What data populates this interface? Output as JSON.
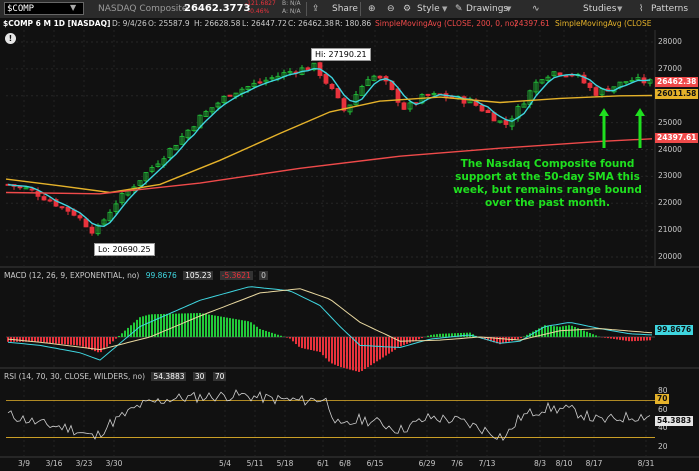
{
  "toolbar": {
    "symbol": "$COMP",
    "name": "NASDAQ Composite",
    "price": "26462.3773",
    "change": "-121.6827",
    "change_pct": "-0.46%",
    "bid": "B: N/A",
    "ask": "A: N/A",
    "share": "Share",
    "style": "Style",
    "drawings": "Drawings",
    "studies": "Studies",
    "patterns": "Patterns"
  },
  "info_bar": {
    "title": "$COMP 6 M 1D [NASDAQ]",
    "date": "D: 9/4/26",
    "open": "O: 25587.9",
    "high": "H: 26628.58",
    "low": "L: 26447.72",
    "close": "C: 26462.38",
    "range": "R: 180.86",
    "sma200": "SimpleMovingAvg (CLOSE, 200, 0, no)",
    "sma200_val": "24397.61",
    "sma50": "SimpleMovingAvg (CLOSE"
  },
  "price_axis": [
    "28000",
    "27000",
    "26000",
    "25000",
    "24000",
    "23000",
    "22000",
    "21000",
    "20000"
  ],
  "price_tags": {
    "last": "26462.38",
    "sma50": "26011.58",
    "sma200": "24397.61"
  },
  "callouts": {
    "hi": "Hi: 27190.21",
    "lo": "Lo: 20690.25"
  },
  "annotation": "The Nasdaq Composite found support at the 50-day SMA this week, but remains range bound over the past month.",
  "macd": {
    "label": "MACD (12, 26, 9, EXPONENTIAL, no)",
    "v1": "99.8676",
    "v2": "105.23",
    "v3": "-5.3621",
    "v4": "0",
    "tag": "99.8676"
  },
  "rsi": {
    "label": "RSI (14, 70, 30, CLOSE, WILDERS, no)",
    "v1": "54.3883",
    "v2": "30",
    "v3": "70",
    "axis": [
      "80",
      "70",
      "60",
      "40",
      "20"
    ],
    "tag": "54.3883",
    "tag70": "70"
  },
  "x_labels": [
    "3/9",
    "3/16",
    "3/23",
    "3/30",
    "5/4",
    "5/11",
    "5/18",
    "6/1",
    "6/8",
    "6/15",
    "6/29",
    "7/6",
    "7/13",
    "8/3",
    "8/10",
    "8/17",
    "8/31"
  ],
  "colors": {
    "up": "#22c93a",
    "down": "#e8323c",
    "sma_fast": "#3fd6e0",
    "sma_mid": "#e5b22a",
    "sma_slow": "#ef4a4a",
    "annot": "#1fe01f"
  }
}
